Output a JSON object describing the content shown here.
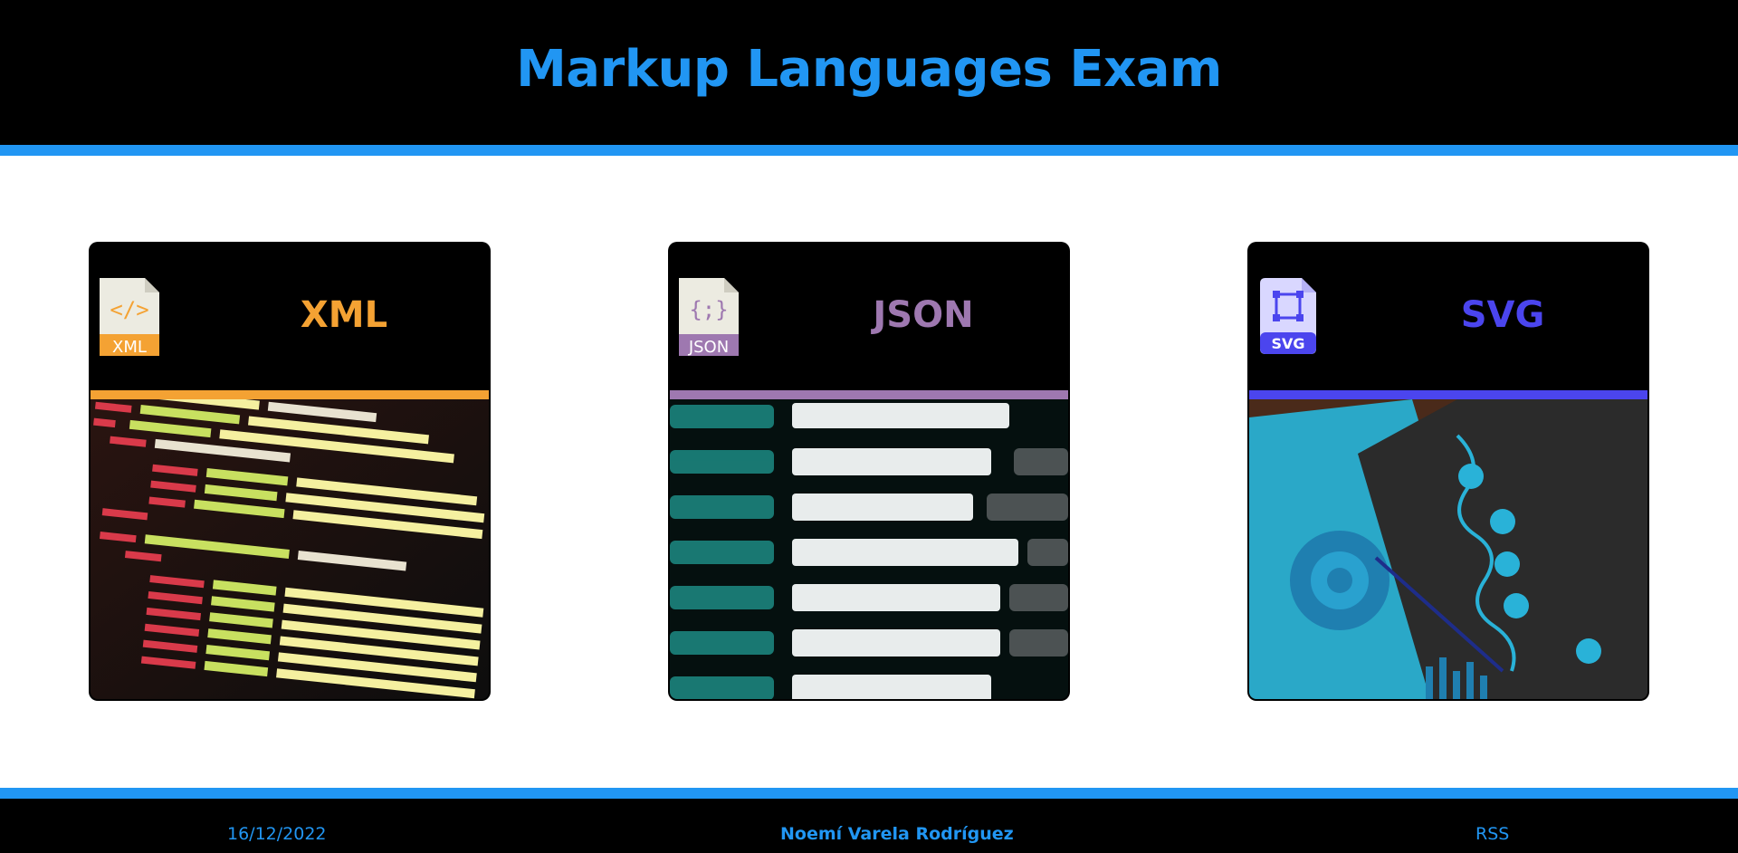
{
  "header": {
    "title": "Markup Languages Exam"
  },
  "cards": [
    {
      "title": "XML",
      "badge": "XML",
      "glyph": "</>",
      "color": "#f4a233"
    },
    {
      "title": "JSON",
      "badge": "JSON",
      "glyph": "{;}",
      "color": "#9e78b0"
    },
    {
      "title": "SVG",
      "badge": "SVG",
      "color": "#4b45ee"
    }
  ],
  "footer": {
    "date": "16/12/2022",
    "author": "Noemí Varela Rodríguez",
    "rss": "RSS"
  }
}
